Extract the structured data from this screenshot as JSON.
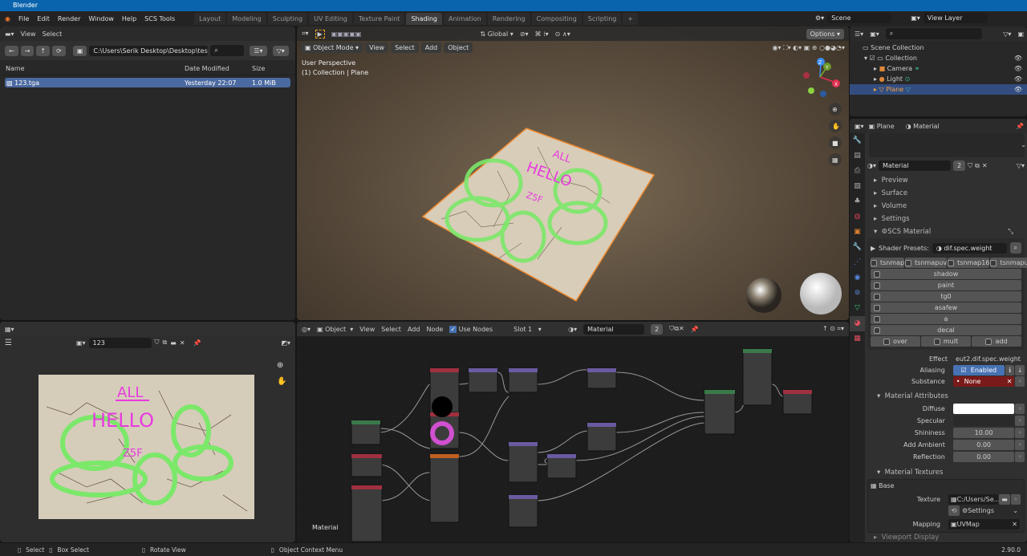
{
  "app_title": "Blender",
  "menu": [
    "File",
    "Edit",
    "Render",
    "Window",
    "Help",
    "SCS Tools"
  ],
  "workspaces": [
    "Layout",
    "Modeling",
    "Sculpting",
    "UV Editing",
    "Texture Paint",
    "Shading",
    "Animation",
    "Rendering",
    "Compositing",
    "Scripting"
  ],
  "active_workspace": "Shading",
  "scene": "Scene",
  "view_layer": "View Layer",
  "file_browser": {
    "menu": [
      "View",
      "Select"
    ],
    "path": "C:\\Users\\Serik Desktop\\Desktop\\test\\ma...",
    "columns": [
      "Name",
      "Date Modified",
      "Size"
    ],
    "files": [
      {
        "name": "123.tga",
        "date": "Yesterday 22:07",
        "size": "1.0 MiB"
      }
    ]
  },
  "viewport": {
    "mode": "Object Mode",
    "menu": [
      "View",
      "Select",
      "Add",
      "Object"
    ],
    "orientation": "Global",
    "options": "Options",
    "overlay_line1": "User Perspective",
    "overlay_line2": "(1) Collection | Plane",
    "image_text": [
      "ALL",
      "HELLO",
      "Z5F"
    ],
    "gizmo": [
      "X",
      "Y",
      "Z"
    ]
  },
  "outliner": {
    "root": "Scene Collection",
    "items": [
      {
        "name": "Collection"
      },
      {
        "name": "Camera"
      },
      {
        "name": "Light"
      },
      {
        "name": "Plane"
      }
    ]
  },
  "image_editor": {
    "image_name": "123"
  },
  "node_editor": {
    "mode": "Object",
    "menu": [
      "View",
      "Select",
      "Add",
      "Node"
    ],
    "use_nodes": "Use Nodes",
    "slot": "Slot 1",
    "material": "Material",
    "users": "2",
    "label": "Material"
  },
  "properties": {
    "object": "Plane",
    "material_tab": "Material",
    "material_name": "Material",
    "users": "2",
    "sections": [
      "Preview",
      "Surface",
      "Volume",
      "Settings"
    ],
    "scs_material": "SCS Material",
    "shader_presets_label": "Shader Presets:",
    "shader_preset": "dif.spec.weight",
    "flags_top": [
      "tsnmap",
      "tsnmapuv",
      "tsnmap16",
      "tsnmapu..."
    ],
    "flags": [
      "shadow",
      "paint",
      "tg0",
      "asafew",
      "a",
      "decal"
    ],
    "flags_bottom": [
      "over",
      "mult",
      "add"
    ],
    "effect_label": "Effect",
    "effect": "eut2.dif.spec.weight",
    "aliasing_label": "Aliasing",
    "aliasing": "Enabled",
    "substance_label": "Substance",
    "substance": "None",
    "attributes_title": "Material Attributes",
    "attributes": [
      {
        "k": "Diffuse",
        "v": ""
      },
      {
        "k": "Specular",
        "v": ""
      },
      {
        "k": "Shininess",
        "v": "10.00"
      },
      {
        "k": "Add Ambient",
        "v": "0.00"
      },
      {
        "k": "Reflection",
        "v": "0.00"
      }
    ],
    "textures_title": "Material Textures",
    "tex_base": "Base",
    "texture_label": "Texture",
    "texture_path": "C:/Users/Se...",
    "settings": "Settings",
    "mapping_label": "Mapping",
    "mapping": "UVMap",
    "viewport_display": "Viewport Display"
  },
  "status": {
    "items": [
      "Select",
      "Box Select",
      "Rotate View",
      "Object Context Menu"
    ],
    "version": "2.90.0"
  },
  "colors": {
    "accent": "#4772b3",
    "selected_row": "#334d80",
    "substance": "#7a1a1a",
    "green": "#7be86a",
    "pink": "#e83ae0"
  }
}
